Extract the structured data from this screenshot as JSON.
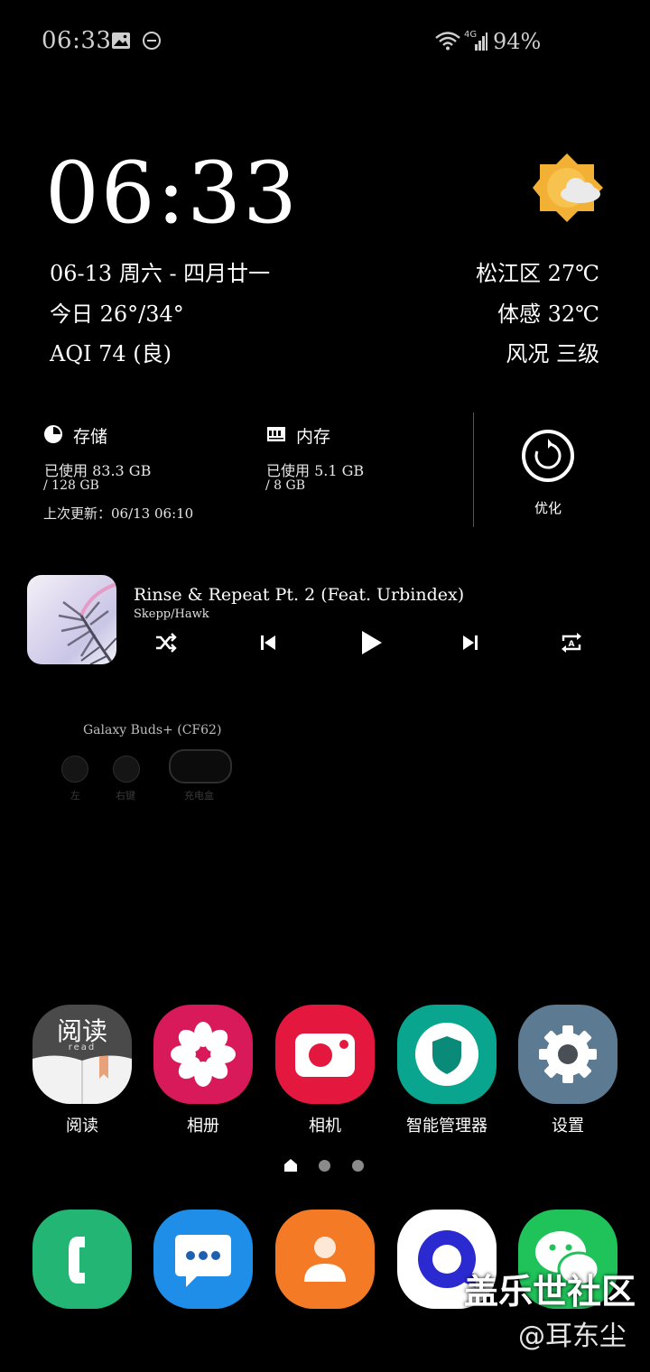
{
  "status_bar": {
    "time": "06:33",
    "network": "4G",
    "battery": "94%",
    "icons": [
      "gallery-notification-icon",
      "do-not-disturb-icon",
      "wifi-icon",
      "signal-icon"
    ]
  },
  "clock_widget": {
    "time": "06:33",
    "date_line": "06-13 周六 - 四月廿一",
    "temp_range": "今日 26°/34°",
    "aqi": "AQI 74 (良)",
    "location_temp": "松江区 27℃",
    "feels_like": "体感 32℃",
    "wind": "风况 三级",
    "weather_icon": "partly-cloudy-icon"
  },
  "device_care": {
    "storage_label": "存储",
    "storage_used": "已使用 83.3 GB",
    "storage_total": "/ 128 GB",
    "memory_label": "内存",
    "memory_used": "已使用 5.1 GB",
    "memory_total": "/ 8 GB",
    "last_update": "上次更新：06/13 06:10",
    "optimize_label": "优化"
  },
  "music": {
    "title": "Rinse & Repeat Pt. 2 (Feat. Urbindex)",
    "artist": "Skepp/Hawk",
    "controls": [
      "shuffle-icon",
      "previous-icon",
      "play-icon",
      "next-icon",
      "repeat-icon"
    ]
  },
  "buds": {
    "device": "Galaxy Buds+ (CF62)",
    "left": "左",
    "right": "右键",
    "case": "充电盒"
  },
  "apps": [
    {
      "label": "阅读",
      "icon": "reader-icon",
      "color": "#4a4a4a",
      "icon_text": "阅读",
      "icon_sub": "read"
    },
    {
      "label": "相册",
      "icon": "gallery-icon",
      "color": "#d8195a"
    },
    {
      "label": "相机",
      "icon": "camera-icon",
      "color": "#e4183f"
    },
    {
      "label": "智能管理器",
      "icon": "device-care-icon",
      "color": "#0aa58f"
    },
    {
      "label": "设置",
      "icon": "settings-icon",
      "color": "#5c7b93"
    }
  ],
  "page_indicator": {
    "count": 3,
    "active": 0
  },
  "dock": [
    {
      "icon": "phone-icon",
      "color": "#22b573"
    },
    {
      "icon": "messages-icon",
      "color": "#1f8ee8"
    },
    {
      "icon": "contacts-icon",
      "color": "#f47a26"
    },
    {
      "icon": "browser-icon",
      "color": "#ffffff"
    },
    {
      "icon": "wechat-icon",
      "color": "#20c35a"
    }
  ],
  "watermark": {
    "title": "盖乐世社区",
    "author": "@耳东尘"
  }
}
